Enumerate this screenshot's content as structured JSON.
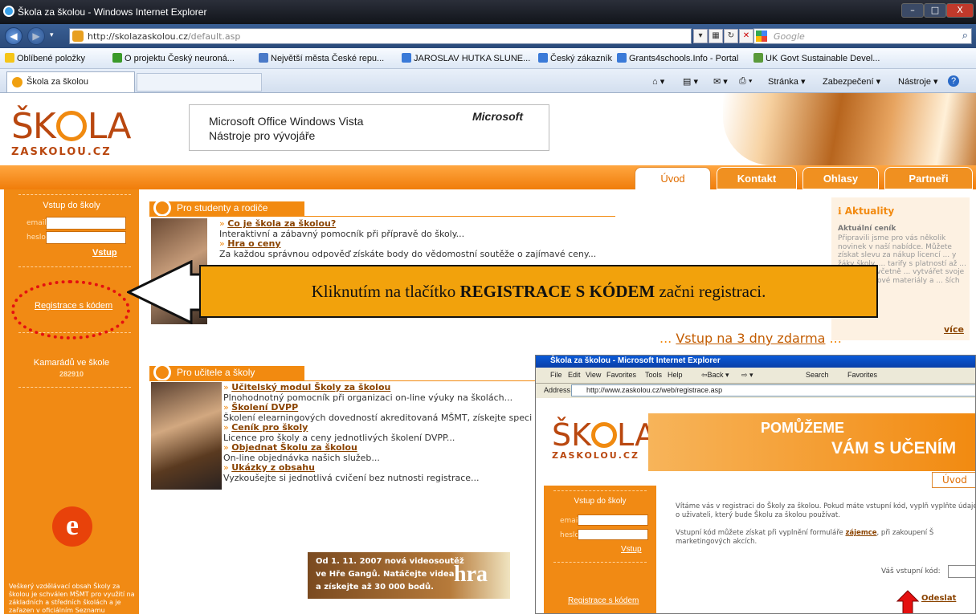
{
  "window": {
    "title": "Škola za školou - Windows Internet Explorer",
    "minimize": "–",
    "maximize": "□",
    "close": "X"
  },
  "address": {
    "url_host": "http://skolazaskolou.cz",
    "url_path": "/default.asp",
    "search_placeholder": "Google"
  },
  "favorites": {
    "label": "Oblíbené položky",
    "items": [
      "O projektu Český neuroná...",
      "Největší města České repu...",
      "JAROSLAV HUTKA SLUNE...",
      "Český zákazník",
      "Grants4schools.Info - Portal",
      "UK Govt Sustainable Devel..."
    ]
  },
  "tab": {
    "label": "Škola za školou"
  },
  "commands": {
    "page": "Stránka ▾",
    "safety": "Zabezpečení ▾",
    "tools": "Nástroje ▾",
    "help": "?"
  },
  "site": {
    "logo_big": "ŠK",
    "logo_big2": "LA",
    "logo_small": "ZASKOLOU.CZ",
    "banner": {
      "line1": "Microsoft Office   Windows Vista",
      "line2": "Nástroje pro vývojáře",
      "brand": "Microsoft"
    },
    "tabs": [
      "Úvod",
      "Kontakt",
      "Ohlasy",
      "Partneři"
    ],
    "login": {
      "heading": "Vstup do školy",
      "email_label": "email",
      "password_label": "heslo",
      "submit": "Vstup"
    },
    "register_link": "Registrace s kódem",
    "friends": {
      "heading": "Kamarádů ve škole",
      "count": "282910"
    },
    "note": "Veškerý vzdělávací obsah Školy za školou je schválen MŠMT pro využití na základních a středních školách a je zařazen v oficiálním Seznamu výukového a vzdělávacího softwaru.",
    "students": {
      "heading": "Pro studenty a rodiče",
      "items": [
        {
          "link": "Co je škola za školou?",
          "desc": "Interaktivní a zábavný pomocník při přípravě do školy..."
        },
        {
          "link": "Hra o ceny",
          "desc": "Za každou správnou odpověď získáte body do vědomostní soutěže o zajímavé ceny..."
        }
      ]
    },
    "free": "Vstup na 3 dny zdarma",
    "teachers": {
      "heading": "Pro učitele a školy",
      "items": [
        {
          "link": "Učitelský modul Školy za školou",
          "desc": "Plnohodnotný pomocník při organizaci on-line výuky na školách..."
        },
        {
          "link": "Školení DVPP",
          "desc": "Školení elearningových dovedností akreditovaná MŠMT, získejte speci"
        },
        {
          "link": "Ceník pro školy",
          "desc": "Licence pro školy a ceny jednotlivých školení DVPP..."
        },
        {
          "link": "Objednat Školu za školou",
          "desc": "On-line objednávka našich služeb..."
        },
        {
          "link": "Ukázky z obsahu",
          "desc": "Vyzkoušejte si jednotlivá cvičení bez nutnosti registrace..."
        }
      ]
    },
    "news": {
      "heading": "Aktuality",
      "subheading": "Aktuální ceník",
      "text": "Připravili jsme pro vás několik novinek v naší nabídce. Můžete získat slevu za nákup licencí ... y žáky školy. ... tarify s platností až ... hodin a to včetně ... vytvářet svoje vlastní ... kové materiály a ... ších výhod.",
      "more": "více"
    },
    "promo": {
      "line1": "Od 1. 11. 2007 nová videosoutěž",
      "line2": "ve Hře Gangů. Natáčejte videa",
      "line3": "a získejte až 30 000 bodů.",
      "logo": "hra"
    }
  },
  "callout": {
    "pre": "Kliknutím na tlačítko ",
    "bold": "REGISTRACE S KÓDEM",
    "post": " začni registraci."
  },
  "inset": {
    "title": "Škola za školou - Microsoft Internet Explorer",
    "menu": [
      "File",
      "Edit",
      "View",
      "Favorites",
      "Tools",
      "Help",
      "⇦Back ▾",
      "⇨ ▾",
      "Search",
      "Favorites"
    ],
    "address_label": "Address",
    "url": "http://www.zaskolou.cz/web/registrace.asp",
    "slogan1": "POMŮŽEME",
    "slogan2": "VÁM S UČENÍM",
    "tab": "Úvod",
    "login_heading": "Vstup do školy",
    "email_label": "email",
    "password_label": "heslo",
    "submit": "Vstup",
    "register_link": "Registrace s kódem",
    "text1": "Vítáme vás v registraci do Školy za školou. Pokud máte vstupní kód, vyplň vyplňte údaje o uživateli, který bude Školu za školou používat.",
    "text2_pre": "Vstupní kód můžete získat při vyplnění formuláře ",
    "text2_link": "zájemce",
    "text2_post": ", při zakoupení Š marketingových akcích.",
    "code_label": "Váš vstupní kód:",
    "send": "Odeslat"
  }
}
